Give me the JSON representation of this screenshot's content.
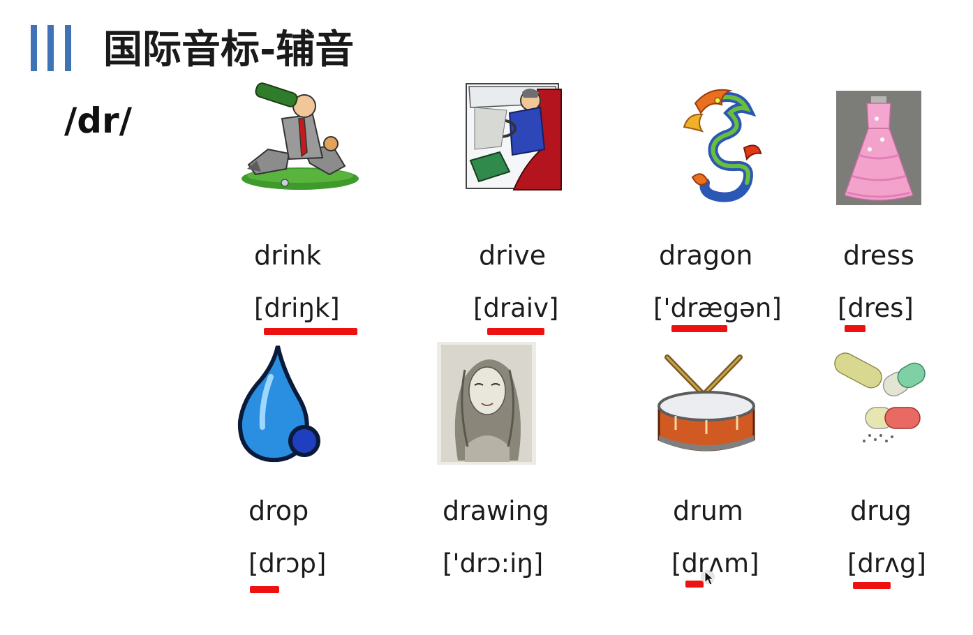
{
  "header": {
    "title": "国际音标-辅音",
    "accent_color": "#3f73b6"
  },
  "phoneme": "/dr/",
  "underline_color": "#ee1111",
  "cards": [
    {
      "word": "drink",
      "ipa": "[driŋk]",
      "icon": "drinking-man-image"
    },
    {
      "word": "drive",
      "ipa": "[draiv]",
      "icon": "driving-car-image"
    },
    {
      "word": "dragon",
      "ipa": "['drægən]",
      "icon": "dragon-image"
    },
    {
      "word": "dress",
      "ipa": "[dres]",
      "icon": "dress-image"
    },
    {
      "word": "drop",
      "ipa": "[drɔp]",
      "icon": "water-drop-image"
    },
    {
      "word": "drawing",
      "ipa": "['drɔ:iŋ]",
      "icon": "portrait-drawing-image"
    },
    {
      "word": "drum",
      "ipa": "[drʌm]",
      "icon": "drum-image"
    },
    {
      "word": "drug",
      "ipa": "[drʌg]",
      "icon": "pills-image"
    }
  ]
}
